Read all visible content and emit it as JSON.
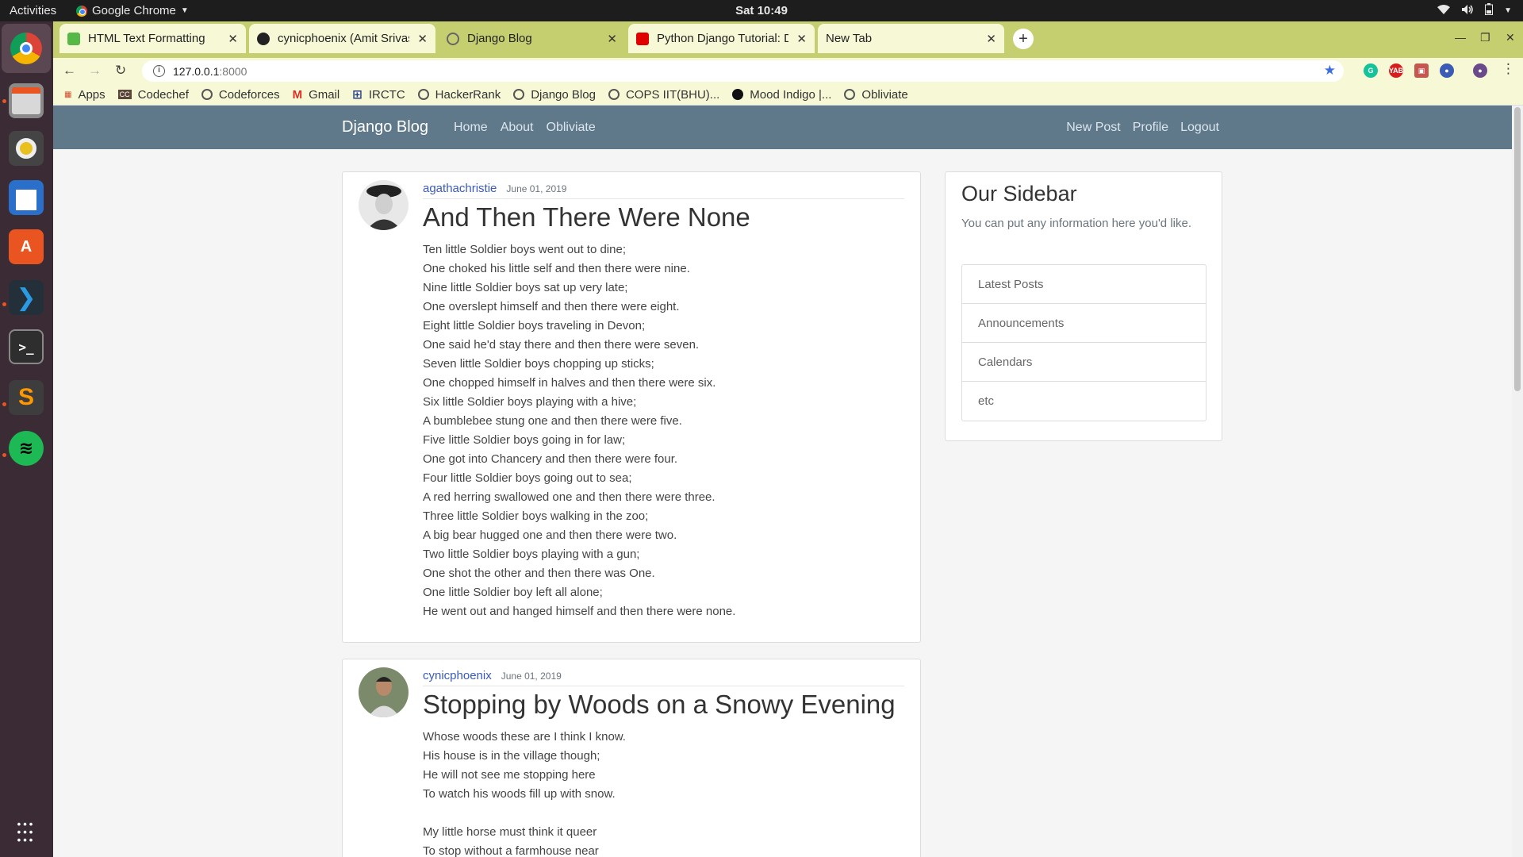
{
  "topbar": {
    "activities": "Activities",
    "app_name": "Google Chrome",
    "clock": "Sat 10:49"
  },
  "tabs": [
    {
      "title": "HTML Text Formatting",
      "favicon_color": "#56b847"
    },
    {
      "title": "cynicphoenix (Amit Srivas",
      "favicon_color": "#222222"
    },
    {
      "title": "Django Blog",
      "favicon_color": "#666666"
    },
    {
      "title": "Python Django Tutorial: D",
      "favicon_color": "#e00000"
    },
    {
      "title": "New Tab",
      "favicon_color": ""
    }
  ],
  "toolbar": {
    "url_host": "127.0.0.1",
    "url_port": ":8000"
  },
  "bookmarks": [
    {
      "label": "Apps",
      "icon": "apps-grid-icon"
    },
    {
      "label": "Codechef",
      "icon": "codechef-icon"
    },
    {
      "label": "Codeforces",
      "icon": "globe-icon"
    },
    {
      "label": "Gmail",
      "icon": "gmail-icon"
    },
    {
      "label": "IRCTC",
      "icon": "irctc-icon"
    },
    {
      "label": "HackerRank",
      "icon": "globe-icon"
    },
    {
      "label": "Django Blog",
      "icon": "globe-icon"
    },
    {
      "label": "COPS IIT(BHU)...",
      "icon": "globe-icon"
    },
    {
      "label": "Mood Indigo |...",
      "icon": "mood-indigo-icon"
    },
    {
      "label": "Obliviate",
      "icon": "globe-icon"
    }
  ],
  "site": {
    "brand": "Django Blog",
    "nav_left": [
      "Home",
      "About",
      "Obliviate"
    ],
    "nav_right": [
      "New Post",
      "Profile",
      "Logout"
    ]
  },
  "posts": [
    {
      "author": "agathachristie",
      "date": "June 01, 2019",
      "title": "And Then There Were None",
      "lines": [
        "Ten little Soldier boys went out to dine;",
        "One choked his little self and then there were nine.",
        "Nine little Soldier boys sat up very late;",
        "One overslept himself and then there were eight.",
        "Eight little Soldier boys traveling in Devon;",
        "One said he'd stay there and then there were seven.",
        "Seven little Soldier boys chopping up sticks;",
        "One chopped himself in halves and then there were six.",
        "Six little Soldier boys playing with a hive;",
        "A bumblebee stung one and then there were five.",
        "Five little Soldier boys going in for law;",
        "One got into Chancery and then there were four.",
        "Four little Soldier boys going out to sea;",
        "A red herring swallowed one and then there were three.",
        "Three little Soldier boys walking in the zoo;",
        "A big bear hugged one and then there were two.",
        "Two little Soldier boys playing with a gun;",
        "One shot the other and then there was One.",
        "One little Soldier boy left all alone;",
        "He went out and hanged himself and then there were none."
      ]
    },
    {
      "author": "cynicphoenix",
      "date": "June 01, 2019",
      "title": "Stopping by Woods on a Snowy Evening",
      "lines": [
        "Whose woods these are I think I know.",
        "His house is in the village though;",
        "He will not see me stopping here",
        "To watch his woods fill up with snow.",
        "",
        "My little horse must think it queer",
        "To stop without a farmhouse near"
      ]
    }
  ],
  "sidebar": {
    "title": "Our Sidebar",
    "subtitle": "You can put any information here you'd like.",
    "items": [
      "Latest Posts",
      "Announcements",
      "Calendars",
      "etc"
    ]
  }
}
